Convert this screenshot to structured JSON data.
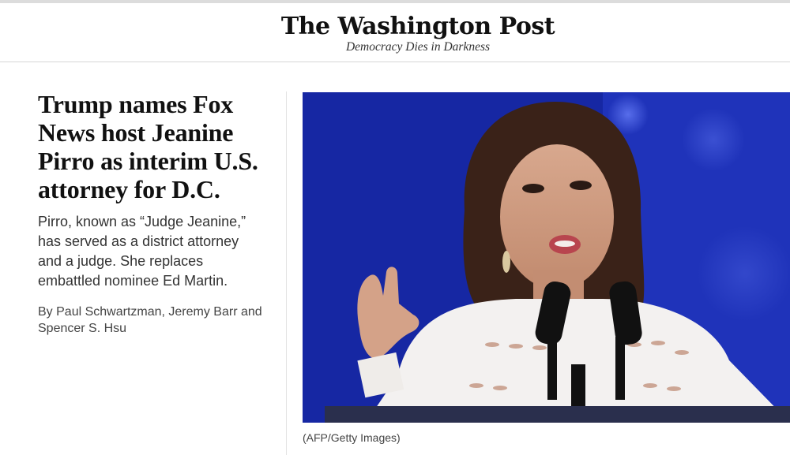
{
  "masthead": {
    "logo": "The Washington Post",
    "tagline": "Democracy Dies in Darkness"
  },
  "article": {
    "headline_lines": [
      "Trump names Fox",
      "News host Jeanine",
      "Pirro as interim U.S.",
      "attorney for D.C."
    ],
    "dek_lines": [
      "Pirro, known as “Judge Jeanine,”",
      "has served as a district attorney",
      "and a judge. She replaces",
      "embattled nominee Ed Martin."
    ],
    "byline_lines": [
      "By Paul Schwartzman, Jeremy Barr and",
      "Spencer S. Hsu"
    ],
    "photo_caption": "(AFP/Getty Images)"
  }
}
